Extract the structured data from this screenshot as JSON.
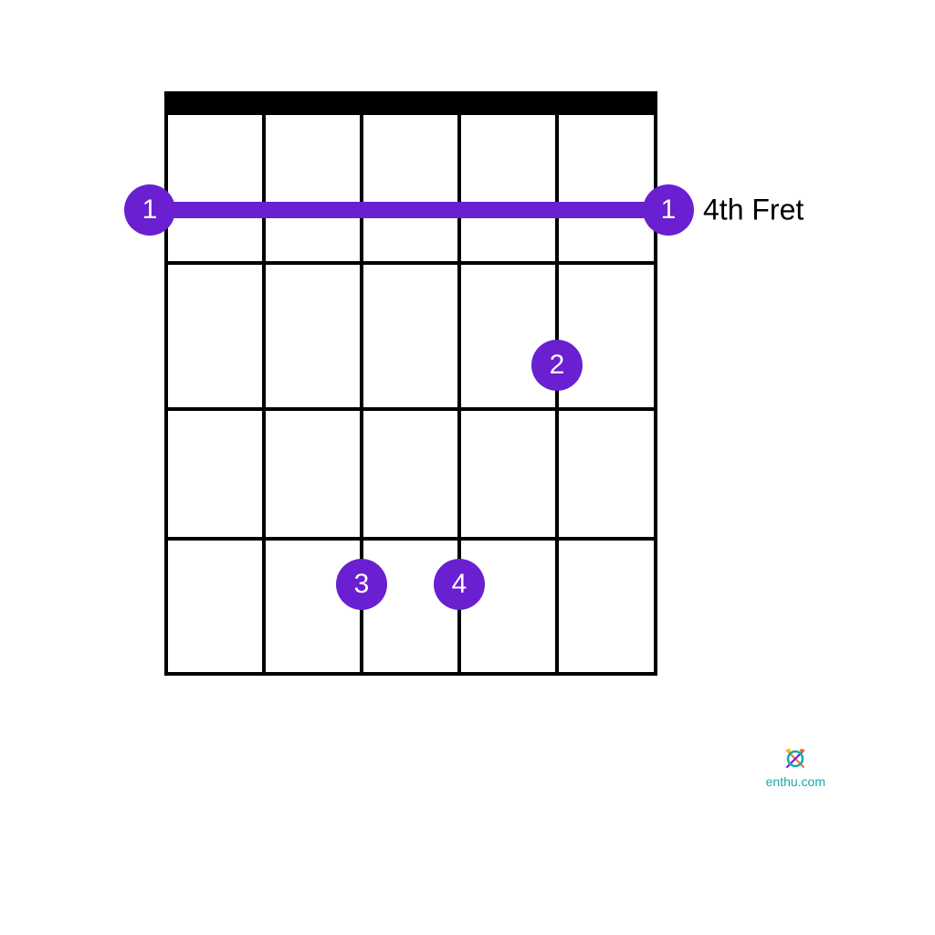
{
  "chart_data": {
    "type": "guitar-chord-diagram",
    "strings": 6,
    "frets_shown": 4,
    "starting_fret": 4,
    "fret_label": "4th Fret",
    "nut_visible": true,
    "barre": {
      "finger": 1,
      "fret_position": 1,
      "from_string": 6,
      "to_string": 1
    },
    "fingers": [
      {
        "finger": "1",
        "string": 6,
        "fret_row": 1,
        "note": "barre-start"
      },
      {
        "finger": "1",
        "string": 1,
        "fret_row": 1,
        "note": "barre-end"
      },
      {
        "finger": "2",
        "string": 2,
        "fret_row": 2
      },
      {
        "finger": "3",
        "string": 4,
        "fret_row": 3
      },
      {
        "finger": "4",
        "string": 3,
        "fret_row": 3
      }
    ],
    "colors": {
      "dot": "#6a1fd0",
      "barre": "#6a1fd0",
      "grid": "#000000"
    }
  },
  "branding": {
    "site": "enthu.com"
  }
}
